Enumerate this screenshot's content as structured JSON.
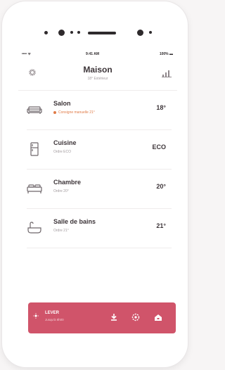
{
  "statusbar": {
    "carrier": "•••• ᯤ",
    "time": "9:41 AM",
    "battery": "100% ▬"
  },
  "header": {
    "title": "Maison",
    "subtitle": "18° Extérieur"
  },
  "rooms": [
    {
      "name": "Salon",
      "detail": "Consigne manuelle 21°",
      "value": "18°",
      "icon": "sofa-icon",
      "alert": true
    },
    {
      "name": "Cuisine",
      "detail": "Ordre ECO",
      "value": "ECO",
      "icon": "fridge-icon",
      "alert": false
    },
    {
      "name": "Chambre",
      "detail": "Ordre 20°",
      "value": "20°",
      "icon": "bed-icon",
      "alert": false
    },
    {
      "name": "Salle de bains",
      "detail": "Ordre 21°",
      "value": "21°",
      "icon": "bathtub-icon",
      "alert": false
    }
  ],
  "mode_bar": {
    "label": "LEVER",
    "sub": "Jusqu'à 8h00",
    "color": "#d0546a"
  },
  "colors": {
    "accent": "#d0546a",
    "alert": "#e07b47"
  }
}
